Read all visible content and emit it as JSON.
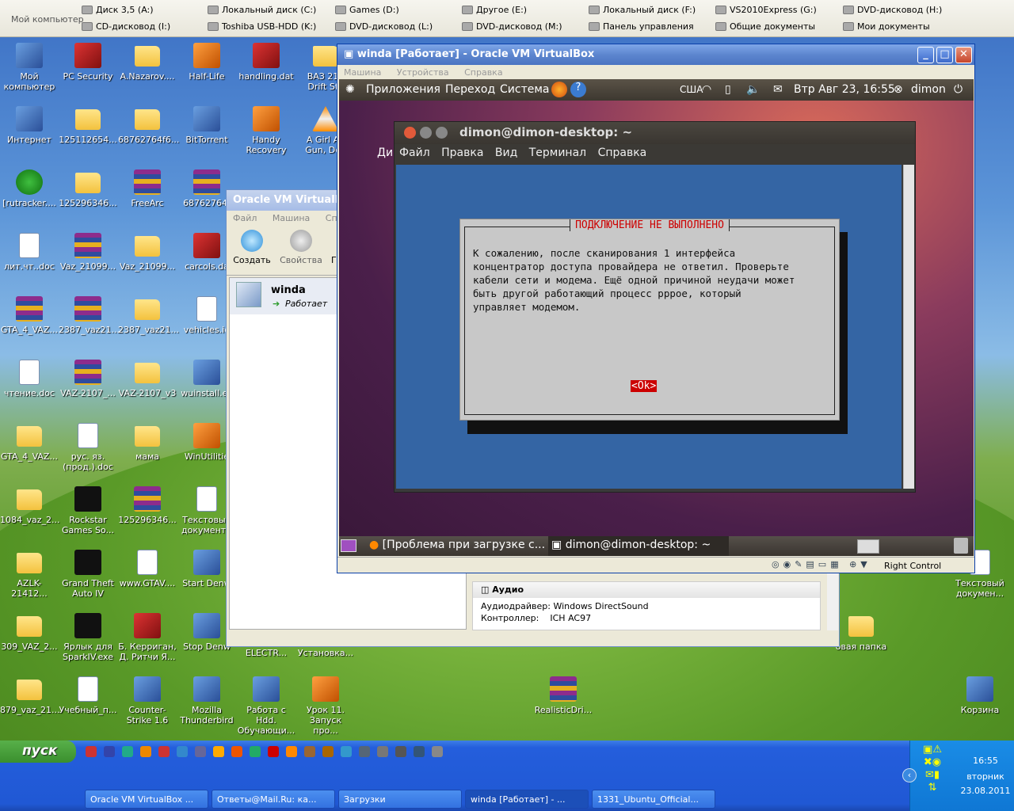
{
  "topbar": {
    "my_computer": "Мой компьютер",
    "drives_row1": [
      "Диск 3,5 (A:)",
      "Локальный диск (C:)",
      "Games (D:)",
      "Другое (E:)",
      "Локальный диск (F:)",
      "VS2010Express (G:)",
      "DVD-дисковод (H:)"
    ],
    "drives_row2": [
      "CD-дисковод (I:)",
      "Toshiba USB-HDD (K:)",
      "DVD-дисковод (L:)",
      "DVD-дисковод (M:)",
      "Панель управления",
      "Общие документы",
      "Мои документы"
    ]
  },
  "desktop_icons": [
    {
      "label": "Мой компьютер",
      "kind": "app"
    },
    {
      "label": "PC Security",
      "kind": "red"
    },
    {
      "label": "A.Nazarov....",
      "kind": "folder"
    },
    {
      "label": "Half-Life",
      "kind": "org"
    },
    {
      "label": "handling.dat",
      "kind": "red"
    },
    {
      "label": "ВАЗ 210 Drift Sty",
      "kind": "folder"
    },
    {
      "label": "Интернет",
      "kind": "app"
    },
    {
      "label": "125112654...",
      "kind": "folder"
    },
    {
      "label": "68762764f6...",
      "kind": "folder"
    },
    {
      "label": "BitTorrent",
      "kind": "app"
    },
    {
      "label": "Handy Recovery",
      "kind": "org"
    },
    {
      "label": "A Girl An Gun, Dea",
      "kind": "cone"
    },
    {
      "label": "[rutracker....",
      "kind": "grn"
    },
    {
      "label": "125296346...",
      "kind": "folder"
    },
    {
      "label": "FreeArc",
      "kind": "rar"
    },
    {
      "label": "68762764f",
      "kind": "rar"
    },
    {
      "label": "лит.чт..doc",
      "kind": "doc"
    },
    {
      "label": "Vaz_21099...",
      "kind": "rar"
    },
    {
      "label": "Vaz_21099...",
      "kind": "folder"
    },
    {
      "label": "carcols.da",
      "kind": "red"
    },
    {
      "label": "GTA_4_VAZ...",
      "kind": "rar"
    },
    {
      "label": "2387_vaz21...",
      "kind": "rar"
    },
    {
      "label": "2387_vaz21...",
      "kind": "folder"
    },
    {
      "label": "vehicles.id",
      "kind": "doc"
    },
    {
      "label": "чтение.doc",
      "kind": "doc"
    },
    {
      "label": "VAZ-2107_...",
      "kind": "rar"
    },
    {
      "label": "VAZ-2107_v3",
      "kind": "folder"
    },
    {
      "label": "wuinstall.ex",
      "kind": "app"
    },
    {
      "label": "GTA_4_VAZ...",
      "kind": "folder"
    },
    {
      "label": "рус. яз. (прод.).doc",
      "kind": "doc"
    },
    {
      "label": "мама",
      "kind": "folder"
    },
    {
      "label": "WinUtilitie",
      "kind": "org"
    },
    {
      "label": "1084_vaz_2...",
      "kind": "folder"
    },
    {
      "label": "Rockstar Games So...",
      "kind": "blk"
    },
    {
      "label": "125296346...",
      "kind": "rar"
    },
    {
      "label": "Текстовый документ.t",
      "kind": "doc"
    },
    {
      "label": "AZLK-21412...",
      "kind": "folder"
    },
    {
      "label": "Grand Theft Auto IV",
      "kind": "blk"
    },
    {
      "label": "www.GTAV....",
      "kind": "doc"
    },
    {
      "label": "Start Denw",
      "kind": "app"
    },
    {
      "label": "309_VAZ_2...",
      "kind": "folder"
    },
    {
      "label": "Ярлык для SparkIV.exe",
      "kind": "blk"
    },
    {
      "label": "Б. Керриган, Д. Ритчи Я...",
      "kind": "red"
    },
    {
      "label": "Stop Denw",
      "kind": "app"
    },
    {
      "label": "879_vaz_21...",
      "kind": "folder"
    },
    {
      "label": "Учебный_п...",
      "kind": "doc"
    },
    {
      "label": "Counter-Strike 1.6",
      "kind": "app"
    },
    {
      "label": "Mozilla Thunderbird",
      "kind": "app"
    },
    {
      "label": "Работа с Hdd. Обучающи...",
      "kind": "app"
    },
    {
      "label": "Урок 11. Запуск про...",
      "kind": "org"
    },
    {
      "label": "RealisticDri...",
      "kind": "rar"
    },
    {
      "label": "ELECTR...",
      "kind": "none"
    },
    {
      "label": "Установка...",
      "kind": "none"
    },
    {
      "label": "Текстовый докумен...",
      "kind": "doc"
    },
    {
      "label": "овая папка",
      "kind": "folder"
    },
    {
      "label": "Корзина",
      "kind": "app"
    }
  ],
  "vbox_manager": {
    "title": "Oracle VM VirtualB",
    "menu": [
      "Файл",
      "Машина",
      "Справ"
    ],
    "create": "Создать",
    "props": "Свойства",
    "g": "Г",
    "vm_name": "winda",
    "vm_state": "Работает",
    "audio_header": "Аудио",
    "audio_driver_label": "Аудиодрайвер:",
    "audio_driver_value": "Windows DirectSound",
    "controller_label": "Контроллер:",
    "controller_value": "ICH AC97"
  },
  "vm_window": {
    "title": "winda [Работает] - Oracle VM VirtualBox",
    "menu": [
      "Машина",
      "Устройства",
      "Справка"
    ],
    "host_key": "Right Control"
  },
  "gnome_panel": {
    "apps": "Приложения",
    "places": "Переход",
    "system": "Система",
    "kbd": "США",
    "clock": "Втр Авг 23, 16:55",
    "user": "dimon"
  },
  "ubuntu_desktop": {
    "partial_label": "Ди"
  },
  "terminal": {
    "title": "dimon@dimon-desktop: ~",
    "menu": [
      "Файл",
      "Правка",
      "Вид",
      "Терминал",
      "Справка"
    ]
  },
  "dialog": {
    "title": "ПОДКЛЮЧЕНИЕ НЕ ВЫПОЛНЕНО",
    "text": "К сожалению, после сканирования 1 интерфейса\nконцентратор доступа провайдера не ответил. Проверьте\nкабели сети и модема. Ещё одной причиной неудачи может\nбыть другой работающий процесс pppoe, который\nуправляет модемом.",
    "ok": "<Ok>"
  },
  "ubuntu_taskbar": {
    "item1": "[Проблема при загрузке с...",
    "item2": "dimon@dimon-desktop: ~"
  },
  "taskbar": {
    "start": "пуск",
    "items": [
      "Oracle VM VirtualBox ...",
      "Ответы@Mail.Ru: ка...",
      "Загрузки",
      "winda [Работает] - ...",
      "1331_Ubuntu_Official..."
    ]
  },
  "tray": {
    "time": "16:55",
    "day": "вторник",
    "date": "23.08.2011"
  }
}
